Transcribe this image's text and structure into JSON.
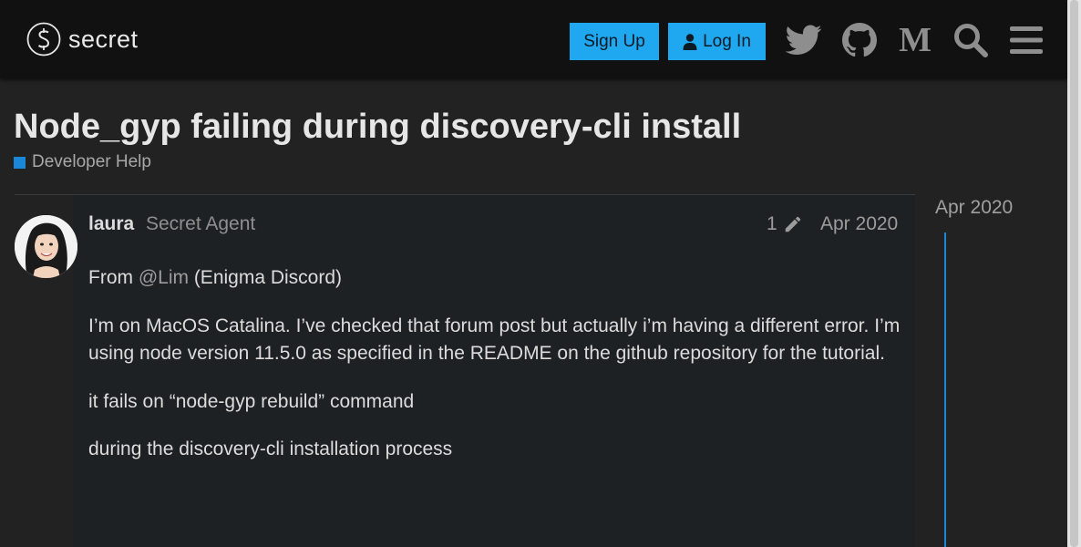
{
  "header": {
    "logo_text": "secret",
    "signup_label": "Sign Up",
    "login_label": "Log In",
    "icons": [
      "twitter-icon",
      "github-icon",
      "medium-icon",
      "search-icon",
      "hamburger-menu-icon"
    ]
  },
  "topic": {
    "title": "Node_gyp failing during discovery-cli install",
    "category": "Developer Help",
    "category_color": "#1a87d9"
  },
  "post": {
    "username": "laura",
    "user_title": "Secret Agent",
    "edit_count": "1",
    "date": "Apr 2020",
    "para1_prefix": "From ",
    "mention": "@Lim",
    "para1_suffix": " (Enigma Discord)",
    "para2": "I’m on MacOS Catalina. I’ve checked that forum post but actually i’m having a different error. I’m using node version 11.5.0 as specified in the README on the github repository for the tutorial.",
    "para3": "it fails on “node-gyp rebuild” command",
    "para4": "during the discovery-cli installation process"
  },
  "timeline": {
    "date": "Apr 2020"
  },
  "colors": {
    "accent": "#1fa7f0",
    "background": "#222222",
    "header": "#111111"
  }
}
